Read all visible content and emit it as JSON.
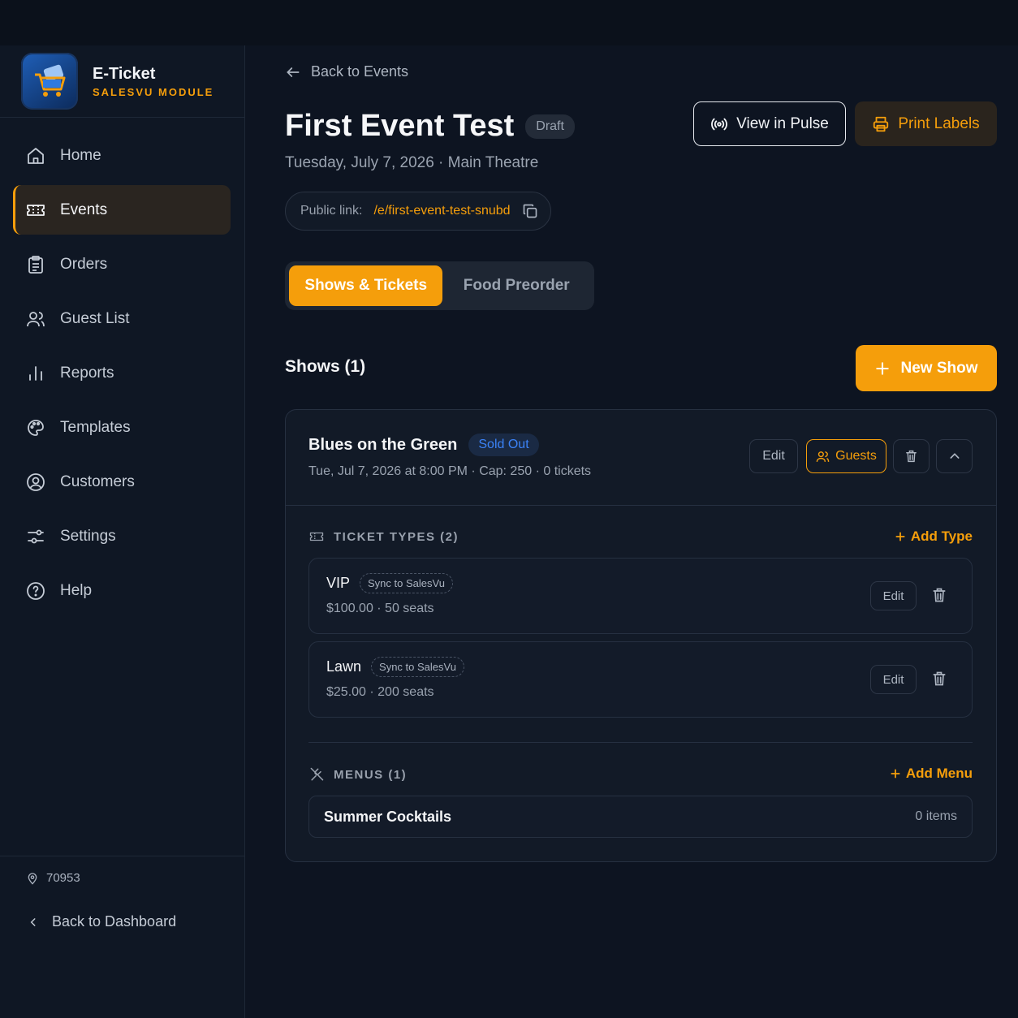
{
  "brand": {
    "name": "E-Ticket",
    "subtitle": "SALESVU MODULE"
  },
  "nav": [
    {
      "label": "Home",
      "icon": "home-icon"
    },
    {
      "label": "Events",
      "icon": "ticket-icon",
      "active": true
    },
    {
      "label": "Orders",
      "icon": "clipboard-icon"
    },
    {
      "label": "Guest List",
      "icon": "users-icon"
    },
    {
      "label": "Reports",
      "icon": "bar-chart-icon"
    },
    {
      "label": "Templates",
      "icon": "palette-icon"
    },
    {
      "label": "Customers",
      "icon": "user-circle-icon"
    },
    {
      "label": "Settings",
      "icon": "sliders-icon"
    },
    {
      "label": "Help",
      "icon": "help-circle-icon"
    }
  ],
  "sidebar_footer": {
    "location_code": "70953",
    "back_label": "Back to Dashboard"
  },
  "header": {
    "back_label": "Back to Events",
    "title": "First Event Test",
    "status_badge": "Draft",
    "subtitle": "Tuesday, July 7, 2026 · Main Theatre",
    "view_pulse_label": "View in Pulse",
    "print_labels_label": "Print Labels",
    "public_link_label": "Public link:",
    "public_link_url": "/e/first-event-test-snubd"
  },
  "tabs": [
    {
      "label": "Shows & Tickets",
      "active": true
    },
    {
      "label": "Food Preorder",
      "active": false
    }
  ],
  "shows": {
    "heading": "Shows (1)",
    "new_show_label": "New Show",
    "items": [
      {
        "name": "Blues on the Green",
        "badge": "Sold Out",
        "meta": "Tue, Jul 7, 2026 at 8:00 PM · Cap: 250 · 0 tickets",
        "edit_label": "Edit",
        "guests_label": "Guests",
        "ticket_types_heading": "TICKET TYPES (2)",
        "add_type_label": "Add Type",
        "ticket_types": [
          {
            "name": "VIP",
            "sync_label": "Sync to SalesVu",
            "meta": "$100.00 · 50 seats",
            "edit_label": "Edit"
          },
          {
            "name": "Lawn",
            "sync_label": "Sync to SalesVu",
            "meta": "$25.00 · 200 seats",
            "edit_label": "Edit"
          }
        ],
        "menus_heading": "MENUS (1)",
        "add_menu_label": "Add Menu",
        "menus": [
          {
            "name": "Summer Cocktails",
            "count": "0 items"
          }
        ]
      }
    ]
  },
  "colors": {
    "accent": "#f59e0b",
    "info": "#3b82f6",
    "background": "#0d1421",
    "panel": "#121a27"
  }
}
